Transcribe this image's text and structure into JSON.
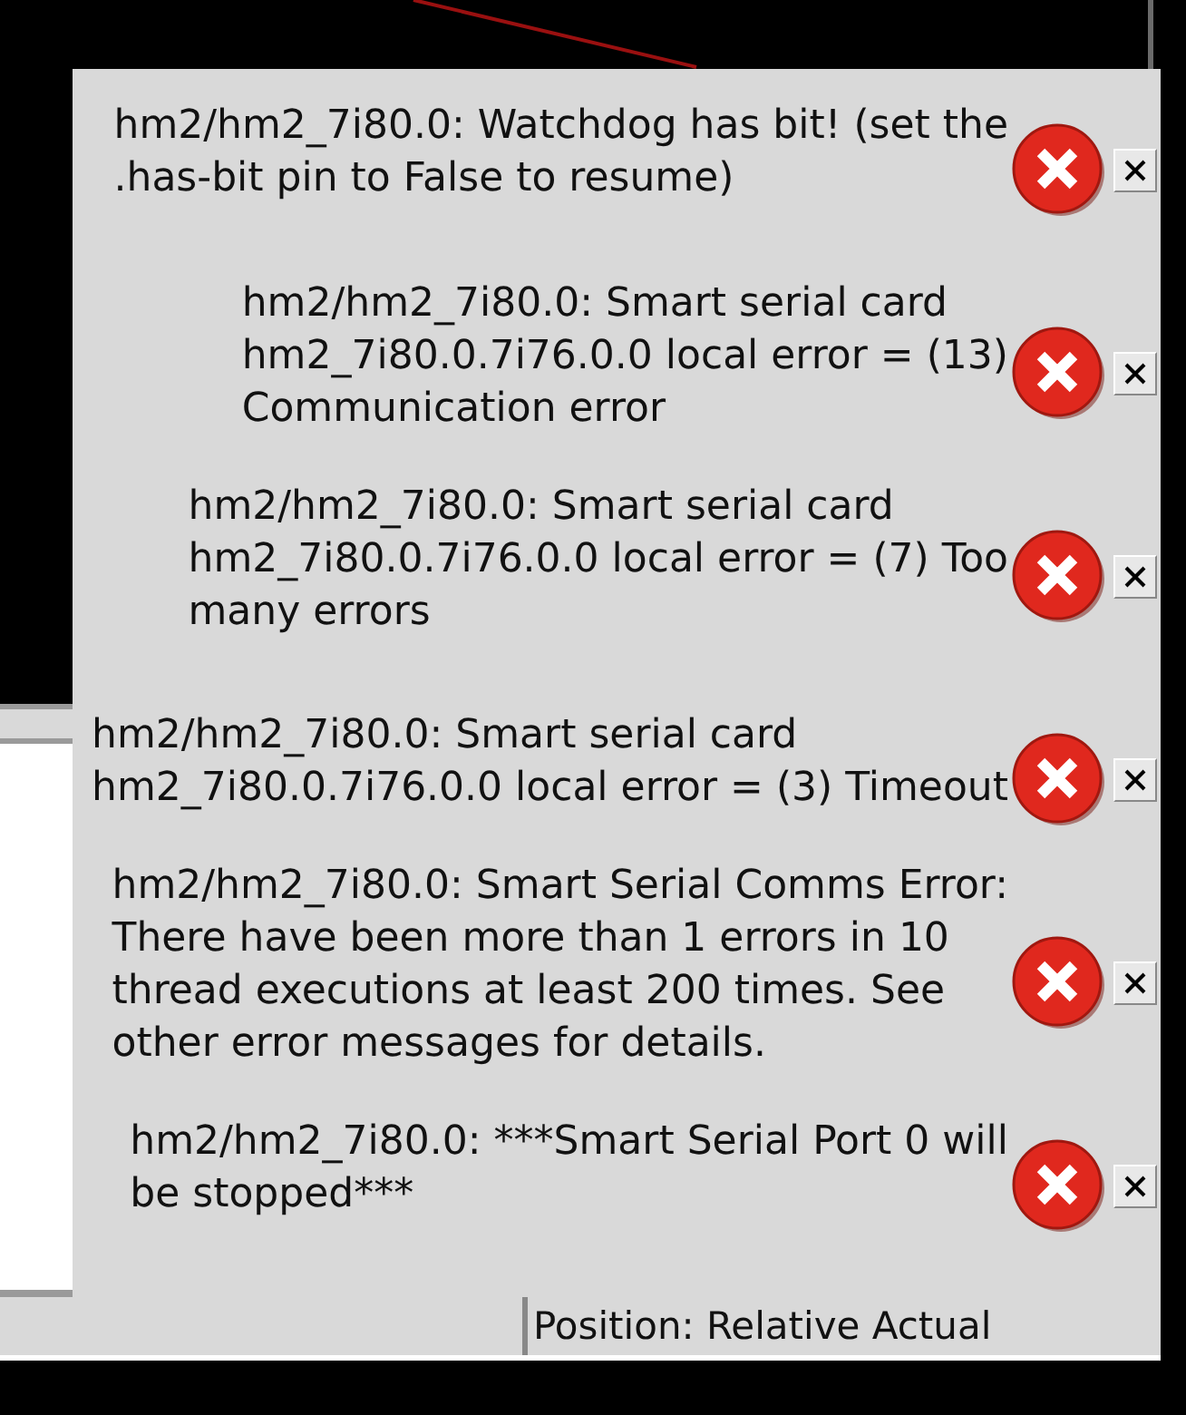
{
  "notifications": [
    {
      "message": "hm2/hm2_7i80.0: Watchdog has bit! (set the\n.has-bit pin to False to resume)"
    },
    {
      "message": "hm2/hm2_7i80.0: Smart serial card\nhm2_7i80.0.7i76.0.0 local error = (13)\nCommunication error"
    },
    {
      "message": "hm2/hm2_7i80.0: Smart serial card\nhm2_7i80.0.7i76.0.0 local error = (7) Too\nmany errors"
    },
    {
      "message": "hm2/hm2_7i80.0: Smart serial card\nhm2_7i80.0.7i76.0.0 local error = (3) Timeout"
    },
    {
      "message": "hm2/hm2_7i80.0: Smart Serial Comms Error:\nThere have been more than 1 errors in 10\nthread executions at least 200 times. See\nother error messages for details."
    },
    {
      "message": "hm2/hm2_7i80.0: ***Smart Serial Port 0 will\nbe stopped***"
    }
  ],
  "status_bar": {
    "position": "Position: Relative Actual"
  }
}
